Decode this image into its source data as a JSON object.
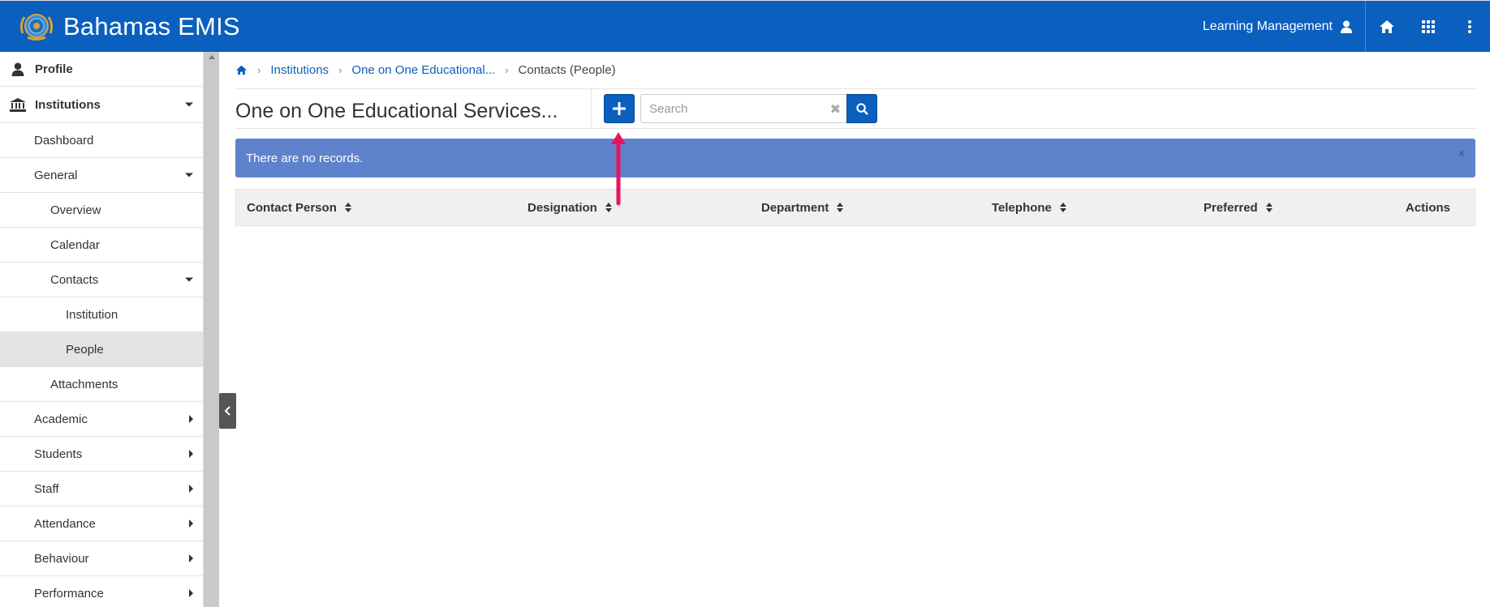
{
  "app": {
    "title": "Bahamas EMIS",
    "brand_color": "#0a5fbf",
    "user_label": "Learning Management",
    "icons": [
      "logo-emblem",
      "user-icon",
      "home-icon",
      "apps-grid-icon",
      "more-vertical-icon"
    ]
  },
  "sidebar": {
    "profile": "Profile",
    "institutions": "Institutions",
    "items": [
      {
        "label": "Dashboard"
      },
      {
        "label": "General"
      },
      {
        "label": "Overview"
      },
      {
        "label": "Calendar"
      },
      {
        "label": "Contacts"
      },
      {
        "label": "Institution"
      },
      {
        "label": "People"
      },
      {
        "label": "Attachments"
      },
      {
        "label": "Academic"
      },
      {
        "label": "Students"
      },
      {
        "label": "Staff"
      },
      {
        "label": "Attendance"
      },
      {
        "label": "Behaviour"
      },
      {
        "label": "Performance"
      }
    ]
  },
  "breadcrumb": {
    "institutions": "Institutions",
    "institution_name": "One on One Educational...",
    "current": "Contacts (People)"
  },
  "page": {
    "title": "One on One Educational Services...",
    "search_placeholder": "Search",
    "alert_text": "There are no records.",
    "alert_close": "×"
  },
  "table": {
    "columns": [
      "Contact Person",
      "Designation",
      "Department",
      "Telephone",
      "Preferred",
      "Actions"
    ],
    "rows": []
  },
  "annotation": {
    "arrow_color": "#e8155c"
  }
}
